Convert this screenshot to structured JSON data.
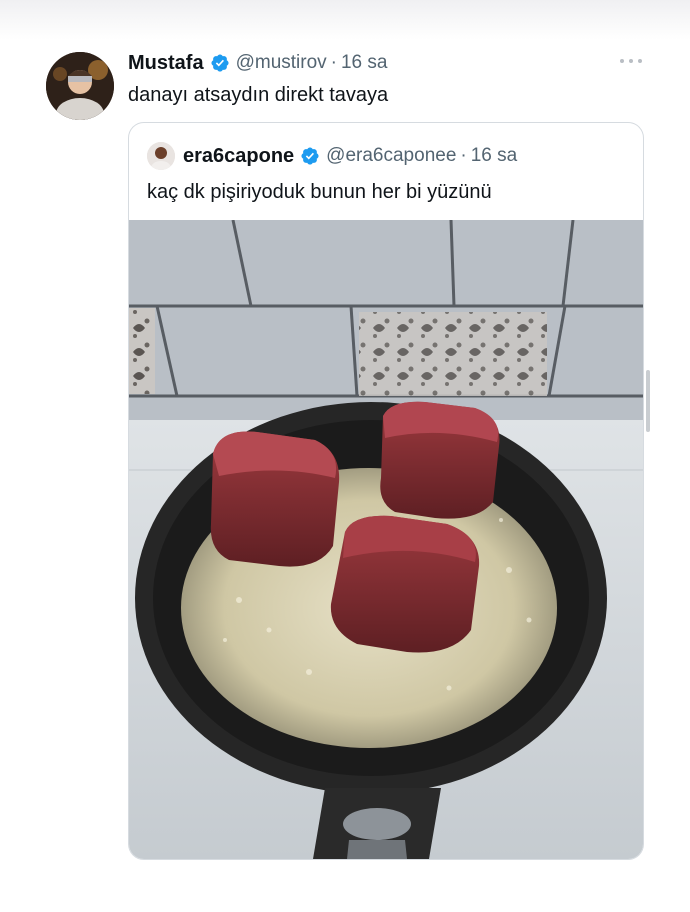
{
  "tweet": {
    "author": {
      "display_name": "Mustafa",
      "handle": "@mustirov",
      "verified": true,
      "time": "16 sa",
      "avatar_icon": "avatar-image"
    },
    "separator": "·",
    "text": "danayı atsaydın direkt tavaya",
    "more_icon": "more-horizontal-icon"
  },
  "quoted_tweet": {
    "author": {
      "display_name": "era6capone",
      "handle": "@era6caponee",
      "verified": true,
      "time": "16 sa",
      "avatar_icon": "avatar-image"
    },
    "separator": "·",
    "text": "kaç dk pişiriyoduk bunun her bi yüzünü",
    "media": {
      "description_icon": "photo-steaks-in-frying-pan"
    }
  },
  "colors": {
    "verified_blue": "#1d9bf0",
    "secondary_text": "#536471",
    "primary_text": "#0f1419",
    "border": "#d6dbe0"
  }
}
